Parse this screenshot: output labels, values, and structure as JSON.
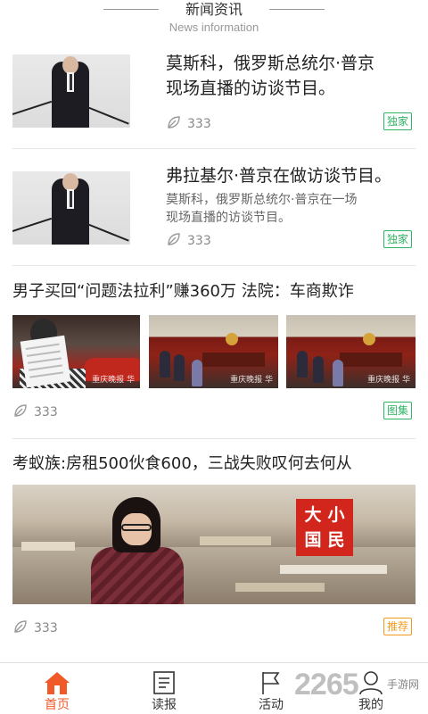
{
  "header": {
    "title": "新闻资讯",
    "subtitle": "News information"
  },
  "news": [
    {
      "title_line1": "莫斯科，俄罗斯总统尔·普京",
      "title_line2": "现场直播的访谈节目。",
      "count": "333",
      "badge": "独家"
    },
    {
      "title_line1": "弗拉基尔·普京在做访谈节目。",
      "sub_line1": "莫斯科，俄罗斯总统尔·普京在一场",
      "sub_line2": "现场直播的访谈节目。",
      "count": "333",
      "badge": "独家"
    },
    {
      "title": "男子买回“问题法拉利”赚360万 法院：车商欺诈",
      "count": "333",
      "badge": "图集",
      "watermark": "重庆晚报 华"
    },
    {
      "title": "考蚁族:房租500伙食600，三战失败叹何去何从",
      "count": "333",
      "badge": "推荐",
      "logo_chars": [
        "大",
        "小",
        "国",
        "民"
      ]
    }
  ],
  "tabbar": [
    {
      "label": "首页",
      "icon": "home-icon",
      "active": true
    },
    {
      "label": "读报",
      "icon": "newspaper-icon",
      "active": false
    },
    {
      "label": "活动",
      "icon": "flag-icon",
      "active": false
    },
    {
      "label": "我的",
      "icon": "profile-icon",
      "active": false
    }
  ],
  "site_watermark": {
    "number": "2265",
    "text": "手游网"
  },
  "colors": {
    "accent": "#f05a28",
    "badge_green": "#2fb463",
    "badge_orange": "#f39a1e"
  }
}
